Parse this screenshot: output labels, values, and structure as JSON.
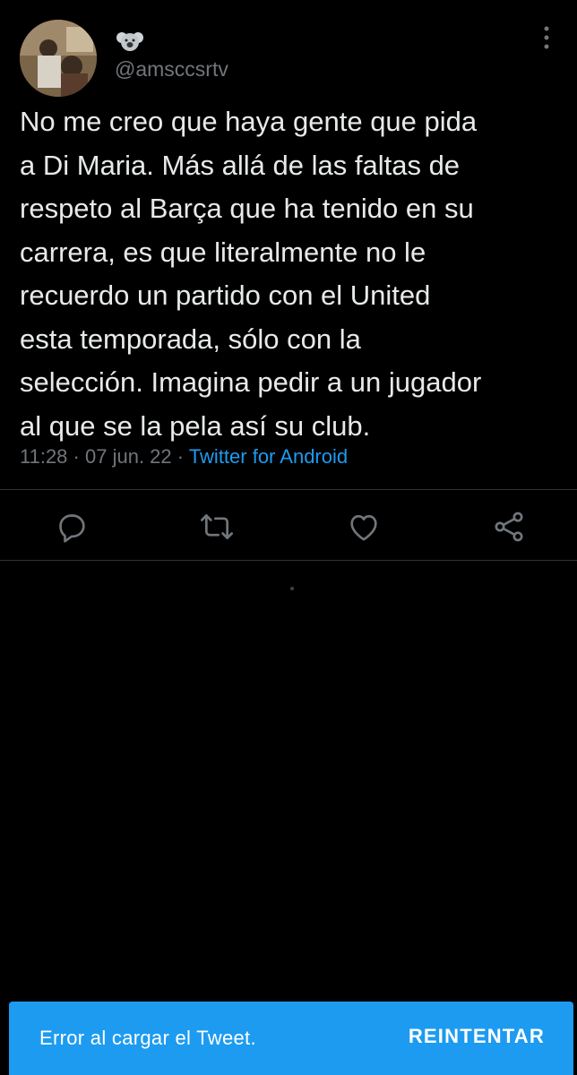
{
  "profile": {
    "display_name_icon": "koala-emoji-icon",
    "handle": "@amsccsrtv"
  },
  "tweet": {
    "text": "No me creo que haya gente que pida\na Di Maria. Más allá de las faltas de\nrespeto al Barça que ha tenido en su\ncarrera, es que literalmente no le\nrecuerdo un partido con el United\nesta temporada, sólo con la\nselección. Imagina pedir a un jugador\nal que se la pela así su club.",
    "time": "11:28",
    "date": "07 jun. 22",
    "separator": "·",
    "source": "Twitter for Android"
  },
  "actions": [
    "reply-icon",
    "retweet-icon",
    "like-icon",
    "share-icon"
  ],
  "toast": {
    "message": "Error al cargar el Tweet.",
    "button": "REINTENTAR"
  },
  "colors": {
    "background": "#000000",
    "secondary_text": "#71767b",
    "link": "#1d9bf0",
    "toast_bg": "#1d9bf0"
  }
}
